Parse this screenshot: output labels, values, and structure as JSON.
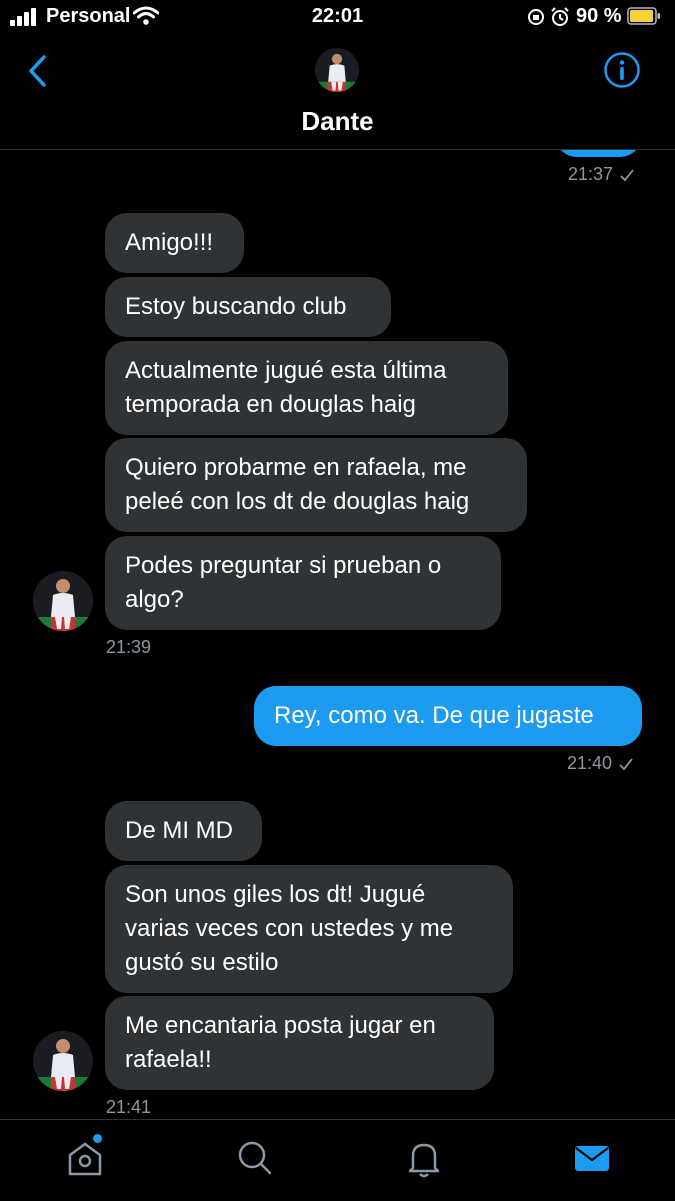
{
  "status_bar": {
    "carrier": "Personal",
    "time": "22:01",
    "battery": "90 %"
  },
  "header": {
    "name": "Dante"
  },
  "conversation": {
    "top_timestamp": "21:37",
    "group1": {
      "messages": [
        "Amigo!!!",
        "Estoy buscando club",
        "Actualmente jugué esta última\ntemporada en douglas haig",
        "Quiero probarme en rafaela, me\npeleé con los dt de douglas haig",
        "Podes preguntar si prueban o\nalgo?"
      ],
      "timestamp": "21:39"
    },
    "sent_message": "Rey, como va. De que jugaste",
    "sent_timestamp": "21:40",
    "group2": {
      "messages": [
        "De MI MD",
        "Son unos giles los dt! Jugué\nvarias veces con ustedes y me\ngustó su estilo",
        "Me encantaria posta jugar en\nrafaela!!"
      ],
      "timestamp": "21:41"
    }
  },
  "colors": {
    "accent": "#1d9bf0",
    "received_bubble": "#2f3336",
    "timestamp": "#8b98a5",
    "battery": "#f7d23a"
  },
  "icons": {
    "tabs": [
      "home-icon",
      "search-icon",
      "notifications-icon",
      "messages-icon"
    ]
  }
}
